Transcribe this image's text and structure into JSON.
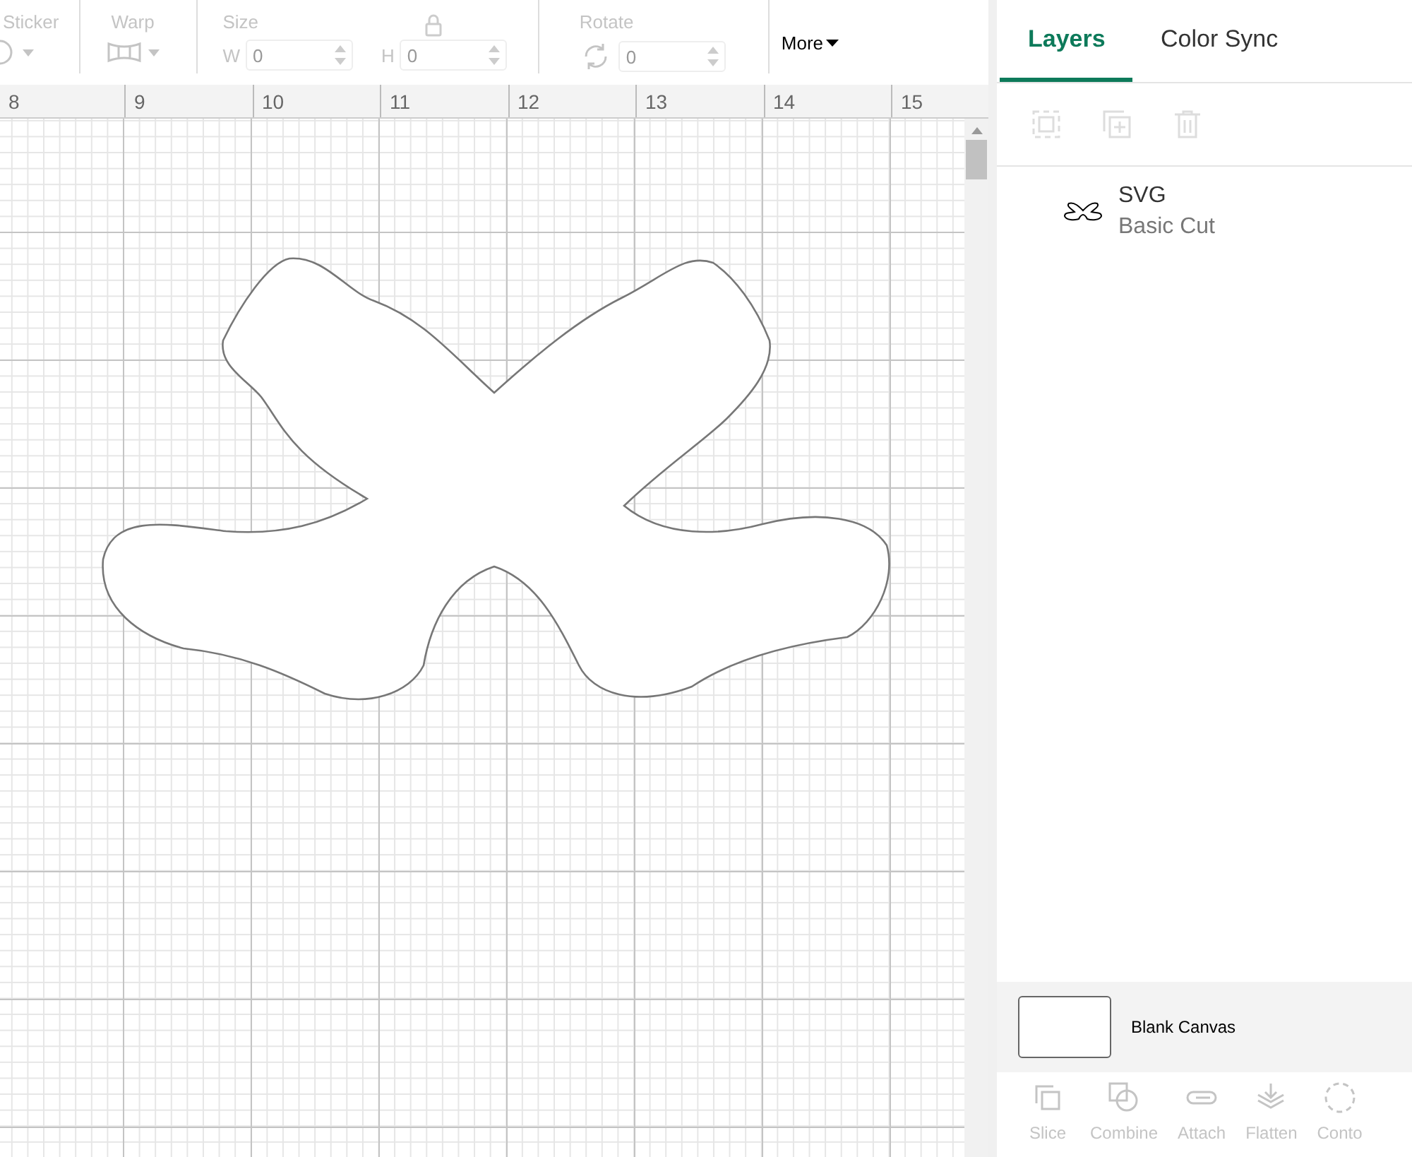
{
  "toolbar": {
    "groups": [
      {
        "kind": "icon",
        "label": "Sticker",
        "disabled": true
      },
      {
        "kind": "icon",
        "label": "Warp",
        "disabled": true
      },
      {
        "kind": "size",
        "label": "Size",
        "disabled": true,
        "w_label": "W",
        "w_value": "0",
        "h_label": "H",
        "h_value": "0"
      },
      {
        "kind": "rotate",
        "label": "Rotate",
        "disabled": true,
        "value": "0"
      }
    ],
    "more": "More"
  },
  "ruler": {
    "ticks": [
      "8",
      "9",
      "10",
      "11",
      "12",
      "13",
      "14",
      "15"
    ]
  },
  "panel": {
    "tabs": [
      {
        "label": "Layers",
        "selected": true
      },
      {
        "label": "Color Sync",
        "selected": false
      }
    ],
    "layers": [
      {
        "name": "SVG",
        "operation": "Basic Cut"
      }
    ],
    "canvas_label": "Blank Canvas",
    "actions": [
      {
        "label": "Slice",
        "disabled": true
      },
      {
        "label": "Combine",
        "disabled": true
      },
      {
        "label": "Attach",
        "disabled": true
      },
      {
        "label": "Flatten",
        "disabled": true
      },
      {
        "label": "Conto",
        "disabled": true
      }
    ]
  }
}
